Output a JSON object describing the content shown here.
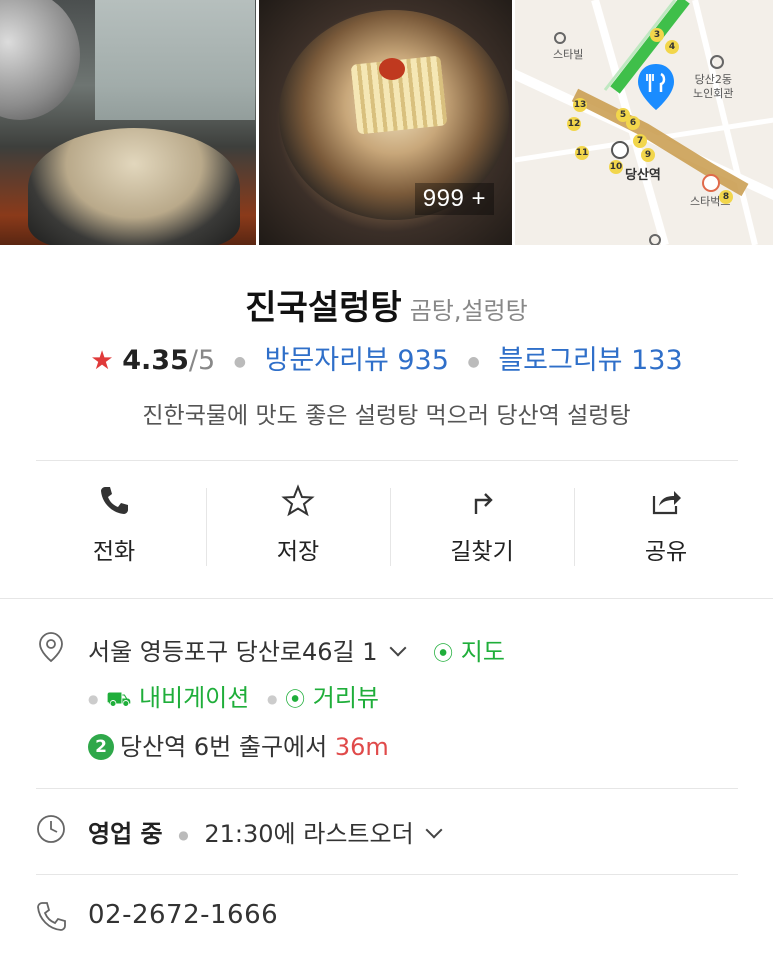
{
  "photos": {
    "count_badge": "999 +"
  },
  "map": {
    "poi_starbucks_top": "스타빌",
    "poi_senior_center": "당산2동\n노인회관",
    "station_name": "당산역",
    "poi_starbucks_right": "스타벅스",
    "exits": [
      "13",
      "12",
      "11",
      "10",
      "9",
      "8",
      "7",
      "6",
      "5",
      "4",
      "3"
    ]
  },
  "place": {
    "name": "진국설렁탕",
    "category": "곰탕,설렁탕",
    "rating": "4.35",
    "rating_max": "/5",
    "visitor_review_label": "방문자리뷰 935",
    "blog_review_label": "블로그리뷰 133",
    "description": "진한국물에 맛도 좋은 설렁탕 먹으러 당산역 설렁탕"
  },
  "actions": {
    "call": "전화",
    "save": "저장",
    "directions": "길찾기",
    "share": "공유"
  },
  "address": {
    "text": "서울 영등포구 당산로46길 1",
    "map_link": "지도",
    "navigation_link": "내비게이션",
    "streetview_link": "거리뷰"
  },
  "subway": {
    "line": "2",
    "station": "당산역",
    "exit_text": "6번 출구에서",
    "distance": "36m"
  },
  "hours": {
    "status": "영업 중",
    "last_order": "21:30에 라스트오더"
  },
  "phone": {
    "number": "02-2672-1666"
  },
  "colors": {
    "accent_green": "#1fae3a",
    "review_blue": "#2f6fc9",
    "star_red": "#e03a3a",
    "distance_red": "#e04a4a",
    "line2_green": "#2fa84a"
  }
}
